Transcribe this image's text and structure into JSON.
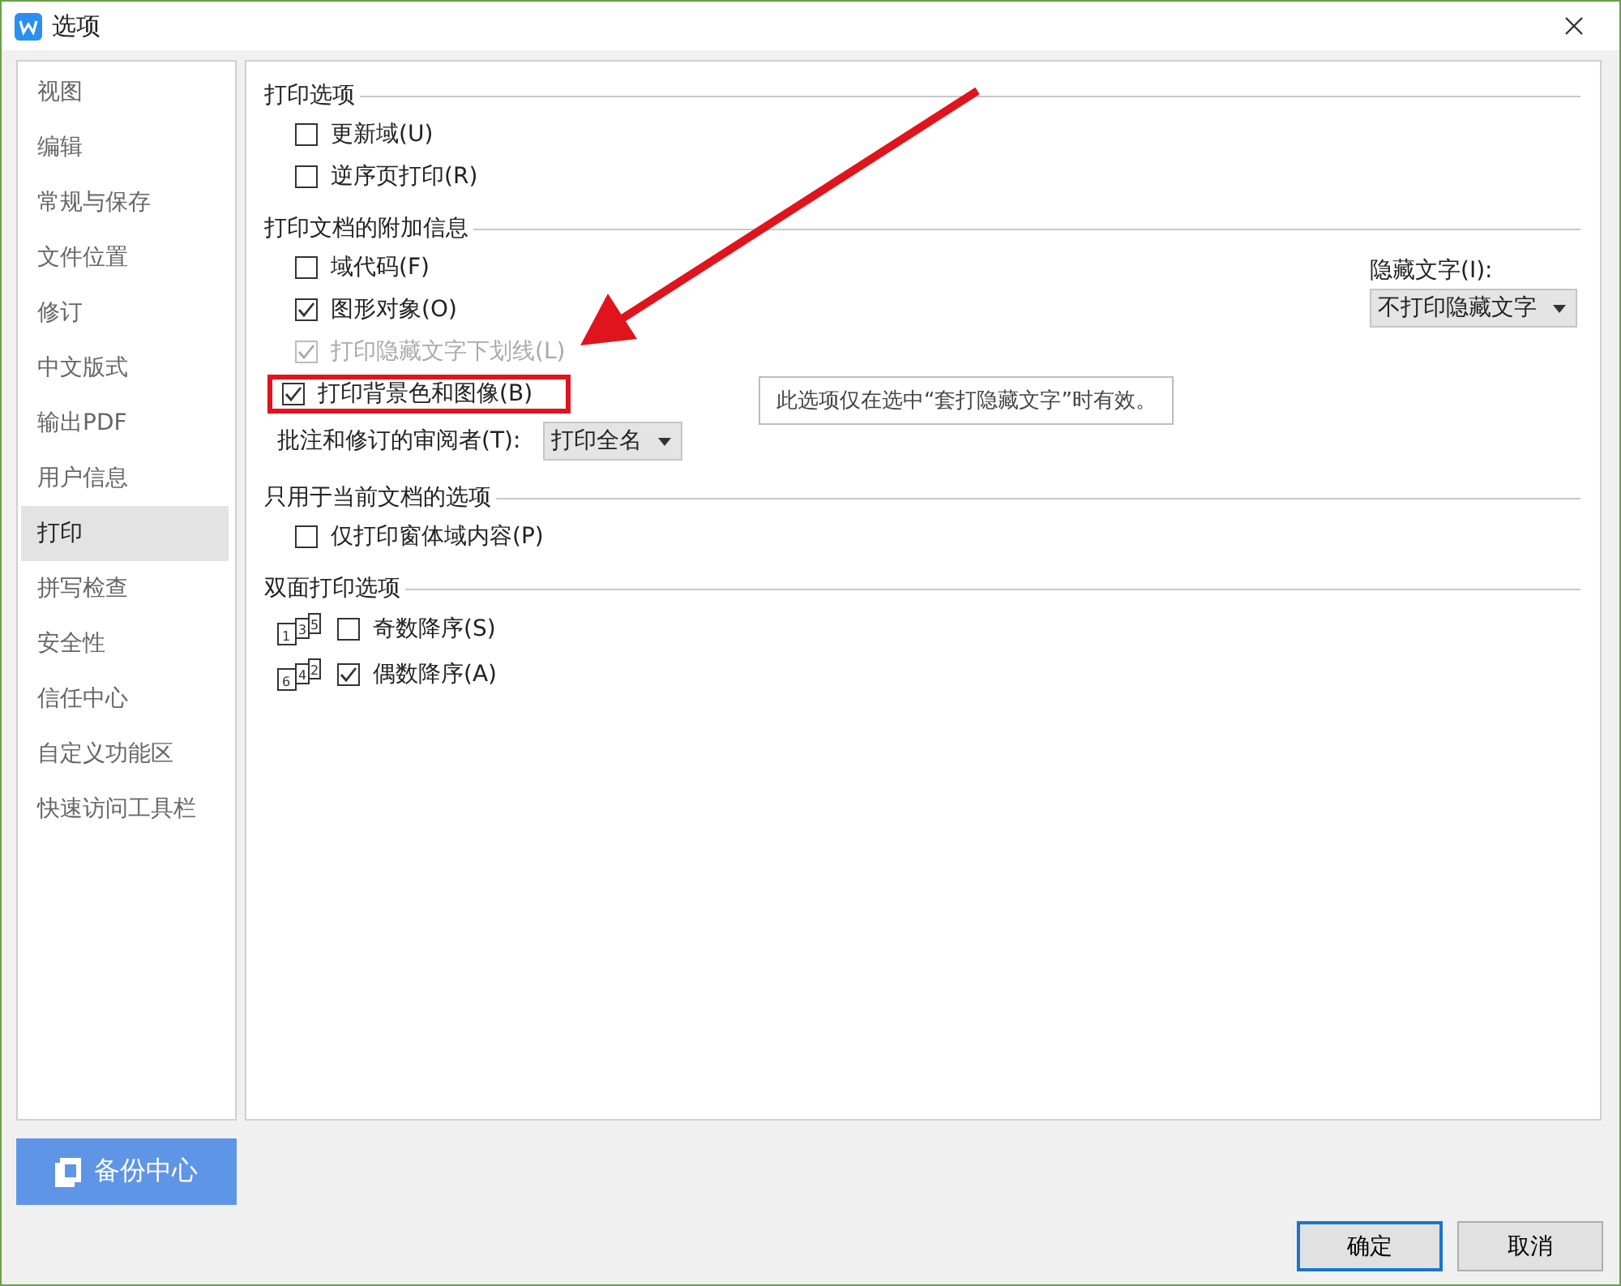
{
  "window": {
    "title": "选项"
  },
  "sidebar": {
    "items": [
      {
        "label": "视图",
        "selected": false
      },
      {
        "label": "编辑",
        "selected": false
      },
      {
        "label": "常规与保存",
        "selected": false
      },
      {
        "label": "文件位置",
        "selected": false
      },
      {
        "label": "修订",
        "selected": false
      },
      {
        "label": "中文版式",
        "selected": false
      },
      {
        "label": "输出PDF",
        "selected": false
      },
      {
        "label": "用户信息",
        "selected": false
      },
      {
        "label": "打印",
        "selected": true
      },
      {
        "label": "拼写检查",
        "selected": false
      },
      {
        "label": "安全性",
        "selected": false
      },
      {
        "label": "信任中心",
        "selected": false
      },
      {
        "label": "自定义功能区",
        "selected": false
      },
      {
        "label": "快速访问工具栏",
        "selected": false
      }
    ]
  },
  "sections": [
    {
      "heading": "打印选项",
      "items": [
        {
          "kind": "checkbox",
          "label": "更新域(U)",
          "checked": false,
          "disabled": false,
          "highlighted": false
        },
        {
          "kind": "checkbox",
          "label": "逆序页打印(R)",
          "checked": false,
          "disabled": false,
          "highlighted": false
        }
      ]
    },
    {
      "heading": "打印文档的附加信息",
      "items": [
        {
          "kind": "checkbox",
          "label": "域代码(F)",
          "checked": false,
          "disabled": false,
          "highlighted": false
        },
        {
          "kind": "checkbox",
          "label": "图形对象(O)",
          "checked": true,
          "disabled": false,
          "highlighted": false
        },
        {
          "kind": "checkbox",
          "label": "打印隐藏文字下划线(L)",
          "checked": true,
          "disabled": true,
          "highlighted": false
        },
        {
          "kind": "checkbox",
          "label": "打印背景色和图像(B)",
          "checked": true,
          "disabled": false,
          "highlighted": true
        },
        {
          "kind": "dropdown",
          "label": "批注和修订的审阅者(T):",
          "value": "打印全名"
        }
      ],
      "hidden_text": {
        "label": "隐藏文字(I):",
        "value": "不打印隐藏文字"
      },
      "note": "此选项仅在选中“套打隐藏文字”时有效。"
    },
    {
      "heading": "只用于当前文档的选项",
      "items": [
        {
          "kind": "checkbox",
          "label": "仅打印窗体域内容(P)",
          "checked": false,
          "disabled": false,
          "highlighted": false
        }
      ]
    },
    {
      "heading": "双面打印选项",
      "items": [
        {
          "kind": "duplex",
          "pages": [
            "1",
            "3",
            "5"
          ],
          "label": "奇数降序(S)",
          "checked": false
        },
        {
          "kind": "duplex",
          "pages": [
            "6",
            "4",
            "2"
          ],
          "label": "偶数降序(A)",
          "checked": true
        }
      ]
    }
  ],
  "backup_button": "备份中心",
  "buttons": [
    {
      "label": "确定",
      "default": true
    },
    {
      "label": "取消",
      "default": false
    }
  ]
}
